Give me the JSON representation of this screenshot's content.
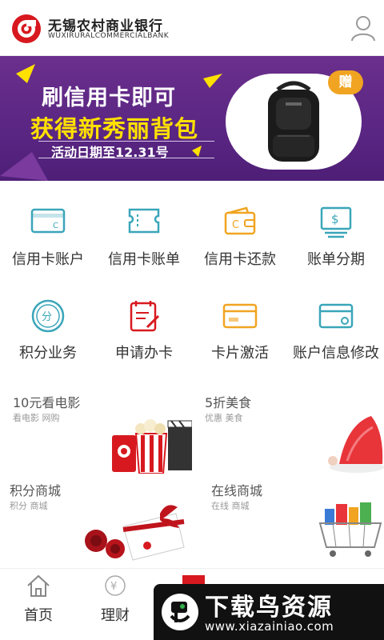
{
  "header": {
    "bank_name_cn": "无锡农村商业银行",
    "bank_name_en": "WUXIRURALCOMMERCIALBANK",
    "user_icon": "user-icon"
  },
  "banner": {
    "line1": "刷信用卡即可",
    "line2": "获得新秀丽背包",
    "date": "活动日期至12.31号",
    "gift_badge": "赠",
    "active_slide": 1,
    "slide_count": 4
  },
  "menu": [
    {
      "label": "信用卡账户",
      "icon": "credit-card-icon"
    },
    {
      "label": "信用卡账单",
      "icon": "bill-icon"
    },
    {
      "label": "信用卡还款",
      "icon": "wallet-icon"
    },
    {
      "label": "账单分期",
      "icon": "installment-icon"
    },
    {
      "label": "积分业务",
      "icon": "points-icon"
    },
    {
      "label": "申请办卡",
      "icon": "apply-card-icon"
    },
    {
      "label": "卡片激活",
      "icon": "card-activate-icon"
    },
    {
      "label": "账户信息修改",
      "icon": "account-edit-icon"
    }
  ],
  "promos": [
    {
      "title": "10元看电影",
      "subtitle": "看电影 网购"
    },
    {
      "title": "5折美食",
      "subtitle": "优惠 美食"
    },
    {
      "title": "积分商城",
      "subtitle": "积分 商城"
    },
    {
      "title": "在线商城",
      "subtitle": "在线 商城"
    }
  ],
  "bottom_nav": [
    {
      "label": "首页",
      "icon": "home-icon"
    },
    {
      "label": "理财",
      "icon": "finance-icon"
    }
  ],
  "watermark": {
    "text": "下载鸟资源",
    "url": "www.xiazainiao.com"
  },
  "colors": {
    "accent_red": "#d7191f",
    "banner_purple": "#5a2683",
    "icon_teal": "#3aa6b9",
    "icon_orange": "#f0a421"
  }
}
